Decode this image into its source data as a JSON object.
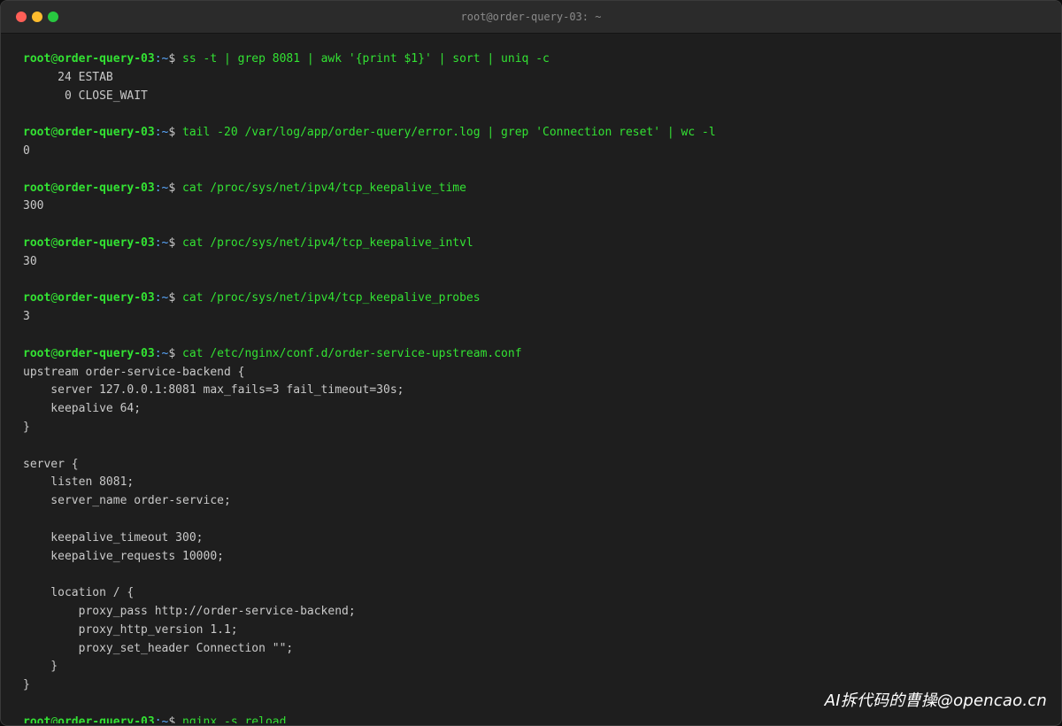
{
  "window": {
    "title": "root@order-query-03: ~"
  },
  "prompt": {
    "user": "root",
    "at": "@",
    "host": "order-query-03",
    "path": ":~",
    "dollar": "$"
  },
  "lines": [
    {
      "type": "prompt",
      "cmd": "ss -t | grep 8081 | awk '{print $1}' | sort | uniq -c"
    },
    {
      "type": "out",
      "text": "     24 ESTAB"
    },
    {
      "type": "out",
      "text": "      0 CLOSE_WAIT"
    },
    {
      "type": "out",
      "text": ""
    },
    {
      "type": "prompt",
      "cmd": "tail -20 /var/log/app/order-query/error.log | grep 'Connection reset' | wc -l"
    },
    {
      "type": "out",
      "text": "0"
    },
    {
      "type": "out",
      "text": ""
    },
    {
      "type": "prompt",
      "cmd": "cat /proc/sys/net/ipv4/tcp_keepalive_time"
    },
    {
      "type": "out",
      "text": "300"
    },
    {
      "type": "out",
      "text": ""
    },
    {
      "type": "prompt",
      "cmd": "cat /proc/sys/net/ipv4/tcp_keepalive_intvl"
    },
    {
      "type": "out",
      "text": "30"
    },
    {
      "type": "out",
      "text": ""
    },
    {
      "type": "prompt",
      "cmd": "cat /proc/sys/net/ipv4/tcp_keepalive_probes"
    },
    {
      "type": "out",
      "text": "3"
    },
    {
      "type": "out",
      "text": ""
    },
    {
      "type": "prompt",
      "cmd": "cat /etc/nginx/conf.d/order-service-upstream.conf"
    },
    {
      "type": "out",
      "text": "upstream order-service-backend {"
    },
    {
      "type": "out",
      "text": "    server 127.0.0.1:8081 max_fails=3 fail_timeout=30s;"
    },
    {
      "type": "out",
      "text": "    keepalive 64;"
    },
    {
      "type": "out",
      "text": "}"
    },
    {
      "type": "out",
      "text": ""
    },
    {
      "type": "out",
      "text": "server {"
    },
    {
      "type": "out",
      "text": "    listen 8081;"
    },
    {
      "type": "out",
      "text": "    server_name order-service;"
    },
    {
      "type": "out",
      "text": ""
    },
    {
      "type": "out",
      "text": "    keepalive_timeout 300;"
    },
    {
      "type": "out",
      "text": "    keepalive_requests 10000;"
    },
    {
      "type": "out",
      "text": ""
    },
    {
      "type": "out",
      "text": "    location / {"
    },
    {
      "type": "out",
      "text": "        proxy_pass http://order-service-backend;"
    },
    {
      "type": "out",
      "text": "        proxy_http_version 1.1;"
    },
    {
      "type": "out",
      "text": "        proxy_set_header Connection \"\";"
    },
    {
      "type": "out",
      "text": "    }"
    },
    {
      "type": "out",
      "text": "}"
    },
    {
      "type": "out",
      "text": ""
    },
    {
      "type": "prompt",
      "cmd": "nginx -s reload"
    }
  ],
  "watermark": "AI拆代码的曹操@opencao.cn"
}
